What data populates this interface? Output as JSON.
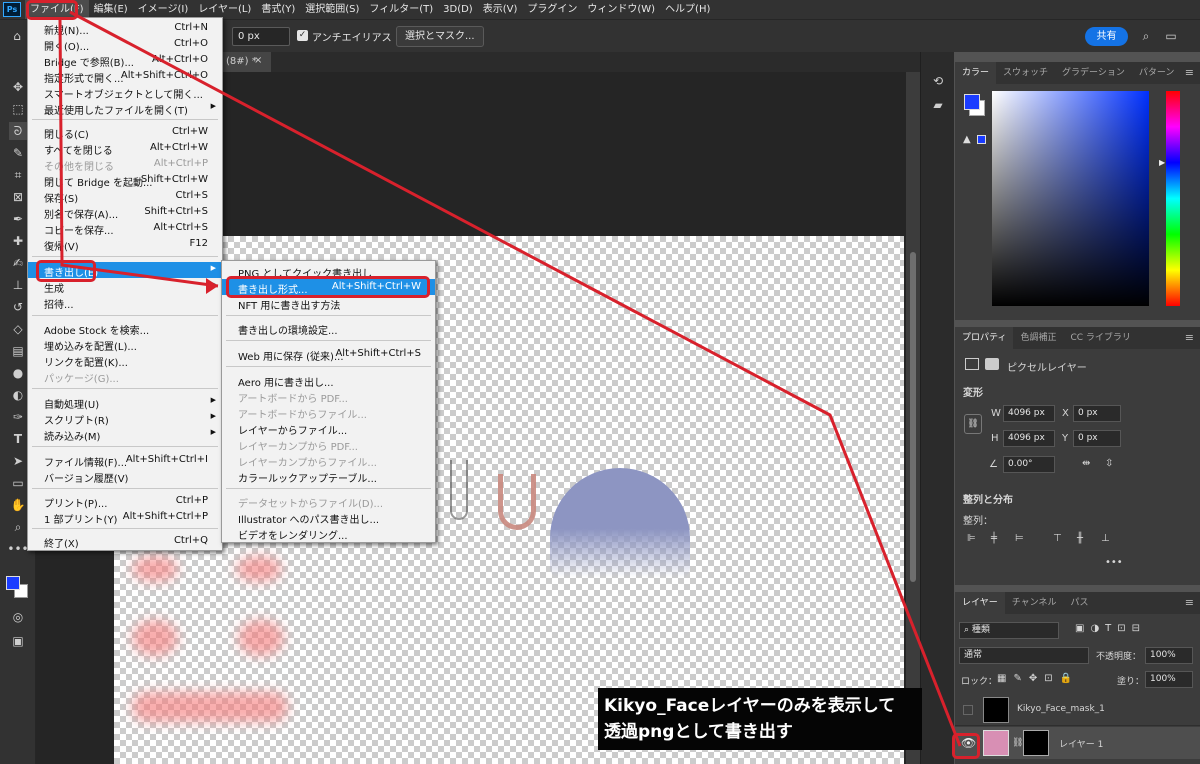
{
  "menubar": {
    "logo": "Ps",
    "items": [
      "ファイル(F)",
      "編集(E)",
      "イメージ(I)",
      "レイヤー(L)",
      "書式(Y)",
      "選択範囲(S)",
      "フィルター(T)",
      "3D(D)",
      "表示(V)",
      "プラグイン",
      "ウィンドウ(W)",
      "ヘルプ(H)"
    ]
  },
  "options": {
    "feather_value": "0 px",
    "antialias_label": "アンチエイリアス",
    "select_mask_label": "選択とマスク...",
    "share_label": "共有"
  },
  "doc_tab": {
    "label": "(8#) *",
    "close": "×"
  },
  "file_menu": {
    "items": [
      {
        "label": "新規(N)...",
        "shortcut": "Ctrl+N"
      },
      {
        "label": "開く(O)...",
        "shortcut": "Ctrl+O"
      },
      {
        "label": "Bridge で参照(B)...",
        "shortcut": "Alt+Ctrl+O"
      },
      {
        "label": "指定形式で開く...",
        "shortcut": "Alt+Shift+Ctrl+O"
      },
      {
        "label": "スマートオブジェクトとして開く...",
        "shortcut": ""
      },
      {
        "label": "最近使用したファイルを開く(T)",
        "shortcut": ""
      },
      {
        "label": "閉じる(C)",
        "shortcut": "Ctrl+W"
      },
      {
        "label": "すべてを閉じる",
        "shortcut": "Alt+Ctrl+W"
      },
      {
        "label": "その他を閉じる",
        "shortcut": "Alt+Ctrl+P"
      },
      {
        "label": "閉じて Bridge を起動...",
        "shortcut": "Shift+Ctrl+W"
      },
      {
        "label": "保存(S)",
        "shortcut": "Ctrl+S"
      },
      {
        "label": "別名で保存(A)...",
        "shortcut": "Shift+Ctrl+S"
      },
      {
        "label": "コピーを保存...",
        "shortcut": "Alt+Ctrl+S"
      },
      {
        "label": "復帰(V)",
        "shortcut": "F12"
      },
      {
        "label": "書き出し(E)",
        "shortcut": ""
      },
      {
        "label": "生成",
        "shortcut": ""
      },
      {
        "label": "招待...",
        "shortcut": ""
      },
      {
        "label": "Adobe Stock を検索...",
        "shortcut": ""
      },
      {
        "label": "埋め込みを配置(L)...",
        "shortcut": ""
      },
      {
        "label": "リンクを配置(K)...",
        "shortcut": ""
      },
      {
        "label": "パッケージ(G)...",
        "shortcut": ""
      },
      {
        "label": "自動処理(U)",
        "shortcut": ""
      },
      {
        "label": "スクリプト(R)",
        "shortcut": ""
      },
      {
        "label": "読み込み(M)",
        "shortcut": ""
      },
      {
        "label": "ファイル情報(F)...",
        "shortcut": "Alt+Shift+Ctrl+I"
      },
      {
        "label": "バージョン履歴(V)",
        "shortcut": ""
      },
      {
        "label": "プリント(P)...",
        "shortcut": "Ctrl+P"
      },
      {
        "label": "1 部プリント(Y)",
        "shortcut": "Alt+Shift+Ctrl+P"
      },
      {
        "label": "終了(X)",
        "shortcut": "Ctrl+Q"
      }
    ]
  },
  "export_menu": {
    "items": [
      {
        "label": "PNG としてクイック書き出し",
        "shortcut": ""
      },
      {
        "label": "書き出し形式...",
        "shortcut": "Alt+Shift+Ctrl+W"
      },
      {
        "label": "NFT 用に書き出す方法",
        "shortcut": ""
      },
      {
        "label": "書き出しの環境設定...",
        "shortcut": ""
      },
      {
        "label": "Web 用に保存 (従来)...",
        "shortcut": "Alt+Shift+Ctrl+S"
      },
      {
        "label": "Aero 用に書き出し...",
        "shortcut": ""
      },
      {
        "label": "アートボードから PDF...",
        "shortcut": ""
      },
      {
        "label": "アートボードからファイル...",
        "shortcut": ""
      },
      {
        "label": "レイヤーからファイル...",
        "shortcut": ""
      },
      {
        "label": "レイヤーカンプから PDF...",
        "shortcut": ""
      },
      {
        "label": "レイヤーカンプからファイル...",
        "shortcut": ""
      },
      {
        "label": "カラールックアップテーブル...",
        "shortcut": ""
      },
      {
        "label": "データセットからファイル(D)...",
        "shortcut": ""
      },
      {
        "label": "Illustrator へのパス書き出し...",
        "shortcut": ""
      },
      {
        "label": "ビデオをレンダリング...",
        "shortcut": ""
      }
    ]
  },
  "color_panel": {
    "tabs": [
      "カラー",
      "スウォッチ",
      "グラデーション",
      "パターン"
    ],
    "fg_color": "#1a3cff",
    "bg_color": "#ffffff"
  },
  "properties_panel": {
    "tabs": [
      "プロパティ",
      "色調補正",
      "CC ライブラリ"
    ],
    "layer_type": "ピクセルレイヤー",
    "transform_header": "変形",
    "w_label": "W",
    "w_value": "4096 px",
    "h_label": "H",
    "h_value": "4096 px",
    "x_label": "X",
    "x_value": "0 px",
    "y_label": "Y",
    "y_value": "0 px",
    "angle_value": "0.00°",
    "align_header": "整列と分布",
    "align_label": "整列："
  },
  "layers_panel": {
    "tabs": [
      "レイヤー",
      "チャンネル",
      "パス"
    ],
    "filter_kind": "種類",
    "blend_mode": "通常",
    "opacity_label": "不透明度：",
    "opacity_value": "100%",
    "lock_label": "ロック：",
    "fill_label": "塗り：",
    "fill_value": "100%",
    "layers": [
      {
        "name": "Kikyo_Face_mask_1",
        "visible": false
      },
      {
        "name": "レイヤー 1",
        "visible": true
      }
    ]
  },
  "caption": {
    "line1": "Kikyo_Faceレイヤーのみを表示して",
    "line2": "透過pngとして書き出す"
  }
}
